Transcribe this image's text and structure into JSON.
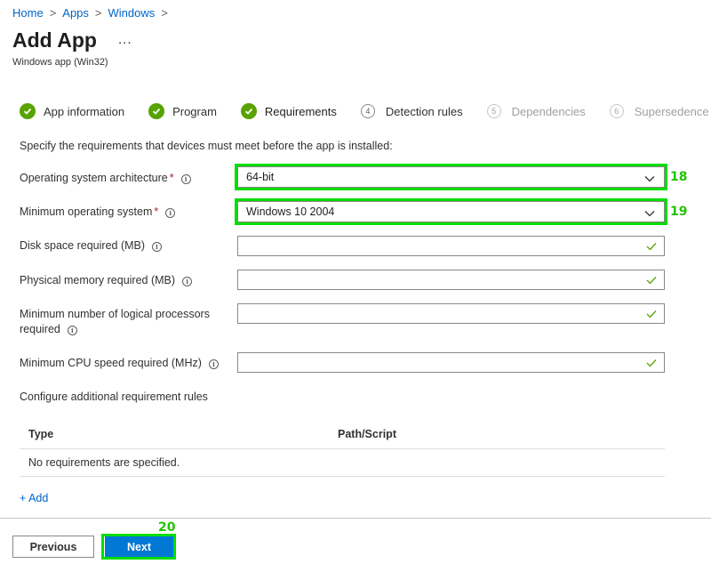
{
  "breadcrumb": {
    "items": [
      "Home",
      "Apps",
      "Windows"
    ]
  },
  "header": {
    "title": "Add App",
    "more": "...",
    "subtitle": "Windows app (Win32)"
  },
  "wizard": {
    "steps": [
      {
        "label": "App information",
        "state": "done"
      },
      {
        "label": "Program",
        "state": "done"
      },
      {
        "label": "Requirements",
        "state": "current"
      },
      {
        "label": "Detection rules",
        "number": "4",
        "state": "pending"
      },
      {
        "label": "Dependencies",
        "number": "5",
        "state": "disabled"
      },
      {
        "label": "Supersedence",
        "number": "6",
        "state": "disabled"
      }
    ]
  },
  "form": {
    "description": "Specify the requirements that devices must meet before the app is installed:",
    "required_marker": "*",
    "os_architecture": {
      "label": "Operating system architecture",
      "value": "64-bit",
      "annotation": "18"
    },
    "min_os": {
      "label": "Minimum operating system",
      "value": "Windows 10 2004",
      "annotation": "19"
    },
    "disk_space": {
      "label": "Disk space required (MB)",
      "value": ""
    },
    "physical_memory": {
      "label": "Physical memory required (MB)",
      "value": ""
    },
    "logical_processors": {
      "label_line1": "Minimum number of logical processors",
      "label_line2": "required",
      "value": ""
    },
    "cpu_speed": {
      "label": "Minimum CPU speed required (MHz)",
      "value": ""
    }
  },
  "requirement_rules": {
    "section_label": "Configure additional requirement rules",
    "columns": [
      "Type",
      "Path/Script"
    ],
    "empty_text": "No requirements are specified.",
    "add_label": "+ Add"
  },
  "footer": {
    "previous_label": "Previous",
    "next_label": "Next",
    "next_annotation": "20"
  },
  "colors": {
    "accent": "#0078d4",
    "success": "#57a300",
    "highlight": "#00dd00",
    "required": "#a4262c"
  }
}
